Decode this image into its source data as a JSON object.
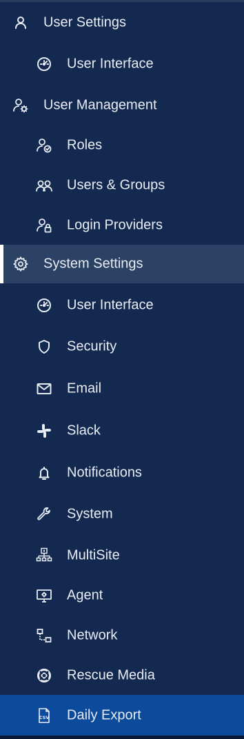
{
  "nav": {
    "user_settings": {
      "label": "User Settings",
      "icon": "user-icon"
    },
    "user_interface_1": {
      "label": "User Interface",
      "icon": "gauge-icon"
    },
    "user_management": {
      "label": "User Management",
      "icon": "user-gear-icon"
    },
    "roles": {
      "label": "Roles",
      "icon": "user-check-icon"
    },
    "users_groups": {
      "label": "Users & Groups",
      "icon": "users-icon"
    },
    "login_providers": {
      "label": "Login Providers",
      "icon": "user-lock-icon"
    },
    "system_settings": {
      "label": "System Settings",
      "icon": "gear-icon"
    },
    "user_interface_2": {
      "label": "User Interface",
      "icon": "gauge-icon"
    },
    "security": {
      "label": "Security",
      "icon": "shield-icon"
    },
    "email": {
      "label": "Email",
      "icon": "envelope-icon"
    },
    "slack": {
      "label": "Slack",
      "icon": "slack-icon"
    },
    "notifications": {
      "label": "Notifications",
      "icon": "bell-icon"
    },
    "system": {
      "label": "System",
      "icon": "wrench-icon"
    },
    "multisite": {
      "label": "MultiSite",
      "icon": "sitemap-icon"
    },
    "agent": {
      "label": "Agent",
      "icon": "monitor-gear-icon"
    },
    "network": {
      "label": "Network",
      "icon": "network-icon"
    },
    "rescue_media": {
      "label": "Rescue Media",
      "icon": "lifebuoy-icon"
    },
    "daily_export": {
      "label": "Daily Export",
      "icon": "csv-file-icon"
    }
  },
  "colors": {
    "background": "#14294f",
    "highlight": "#2c4264",
    "active": "#0c4a9c",
    "text": "#e8edf5"
  }
}
